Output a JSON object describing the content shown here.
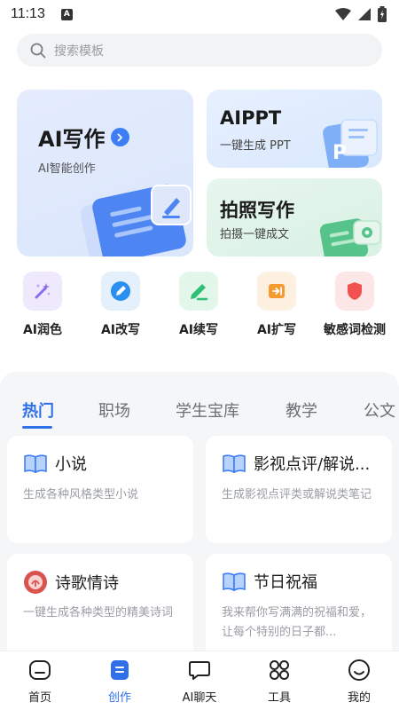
{
  "status_bar": {
    "time": "11:13",
    "notif_letter": "A"
  },
  "search": {
    "placeholder": "搜索模板"
  },
  "cards": {
    "ai_writing": {
      "title": "AI写作",
      "subtitle": "AI智能创作"
    },
    "aippt": {
      "title": "AIPPT",
      "subtitle": "一键生成 PPT",
      "art_letter": "P"
    },
    "photo_writing": {
      "title": "拍照写作",
      "subtitle": "拍摄一键成文"
    }
  },
  "tools": [
    {
      "label": "AI润色",
      "icon": "magic-wand-icon",
      "color": "#8b6cf0"
    },
    {
      "label": "AI改写",
      "icon": "edit-pen-icon",
      "color": "#2a8ff0"
    },
    {
      "label": "AI续写",
      "icon": "pencil-icon",
      "color": "#2fbf75"
    },
    {
      "label": "AI扩写",
      "icon": "expand-icon",
      "color": "#f59a2e"
    },
    {
      "label": "敏感词检测",
      "icon": "shield-icon",
      "color": "#f0524f"
    }
  ],
  "tabs": [
    "热门",
    "职场",
    "学生宝库",
    "教学",
    "公文"
  ],
  "active_tab": "热门",
  "templates": [
    {
      "title": "小说",
      "desc": "生成各种风格类型小说",
      "icon": "book-icon"
    },
    {
      "title": "影视点评/解说...",
      "desc": "生成影视点评类或解说类笔记",
      "icon": "book-icon"
    },
    {
      "title": "诗歌情诗",
      "desc": "一键生成各种类型的精美诗词",
      "icon": "poem-seal-icon"
    },
    {
      "title": "节日祝福",
      "desc": "我来帮你写满满的祝福和爱，让每个特别的日子都...",
      "icon": "book-icon"
    }
  ],
  "nav": [
    {
      "label": "首页",
      "icon": "home-icon"
    },
    {
      "label": "创作",
      "icon": "create-icon"
    },
    {
      "label": "AI聊天",
      "icon": "chat-icon"
    },
    {
      "label": "工具",
      "icon": "grid-icon"
    },
    {
      "label": "我的",
      "icon": "profile-icon"
    }
  ],
  "active_nav": "创作",
  "colors": {
    "accent": "#2f6fea",
    "card_blue": "#dbe6fc",
    "card_green": "#d9f1e4"
  }
}
